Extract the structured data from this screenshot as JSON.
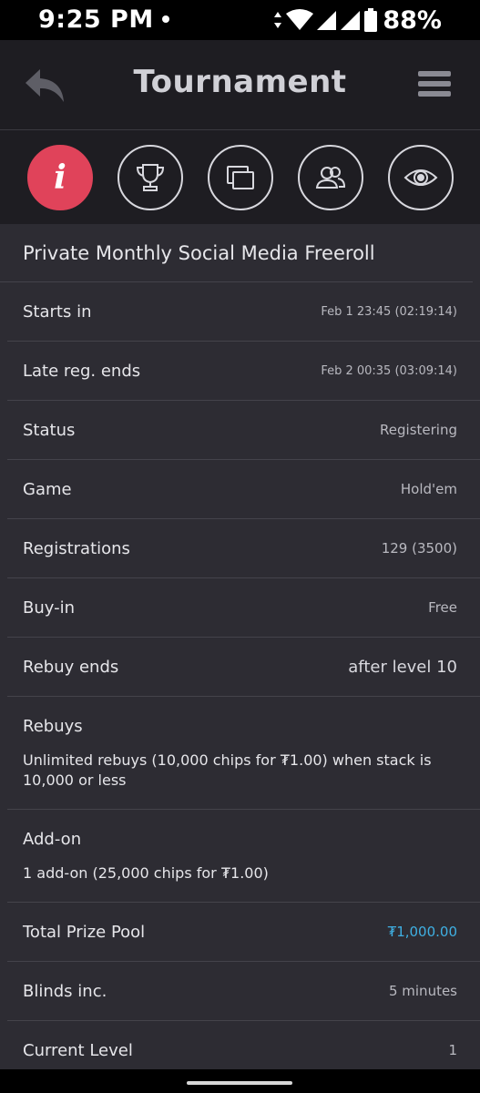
{
  "status_bar": {
    "time": "9:25 PM",
    "battery": "88%",
    "icons": [
      "notification-dot-icon",
      "data-arrows-icon",
      "wifi-icon",
      "signal-icon",
      "signal-icon",
      "battery-icon"
    ]
  },
  "header": {
    "title": "Tournament",
    "back_icon": "back-arrow-icon",
    "menu_icon": "hamburger-menu-icon"
  },
  "tabs": [
    {
      "icon": "info-icon",
      "glyph": "i",
      "active": true
    },
    {
      "icon": "trophy-icon",
      "active": false
    },
    {
      "icon": "tables-icon",
      "active": false
    },
    {
      "icon": "players-icon",
      "active": false
    },
    {
      "icon": "eye-icon",
      "active": false
    }
  ],
  "tournament": {
    "name": "Private Monthly Social Media Freeroll",
    "rows": [
      {
        "label": "Starts in",
        "value": "Feb 1 23:45 (02:19:14)"
      },
      {
        "label": "Late reg. ends",
        "value": "Feb 2 00:35 (03:09:14)"
      },
      {
        "label": "Status",
        "value": "Registering"
      },
      {
        "label": "Game",
        "value": "Hold'em"
      },
      {
        "label": "Registrations",
        "value": "129 (3500)"
      },
      {
        "label": "Buy-in",
        "value": "Free"
      },
      {
        "label": "Rebuy ends",
        "value": "after level 10"
      }
    ],
    "rebuys": {
      "label": "Rebuys",
      "text": "Unlimited rebuys (10,000 chips for ₮1.00) when stack is 10,000 or less"
    },
    "addon": {
      "label": "Add-on",
      "text": "1 add-on (25,000 chips for ₮1.00)"
    },
    "rows2": [
      {
        "label": "Total Prize Pool",
        "value": "₮1,000.00"
      },
      {
        "label": "Blinds inc.",
        "value": "5 minutes"
      },
      {
        "label": "Current Level",
        "value": "1"
      }
    ]
  },
  "colors": {
    "accent_active_tab": "#e0435a",
    "prize_pool": "#3fb0e3",
    "background": "#2d2c33",
    "header": "#1e1d22"
  }
}
